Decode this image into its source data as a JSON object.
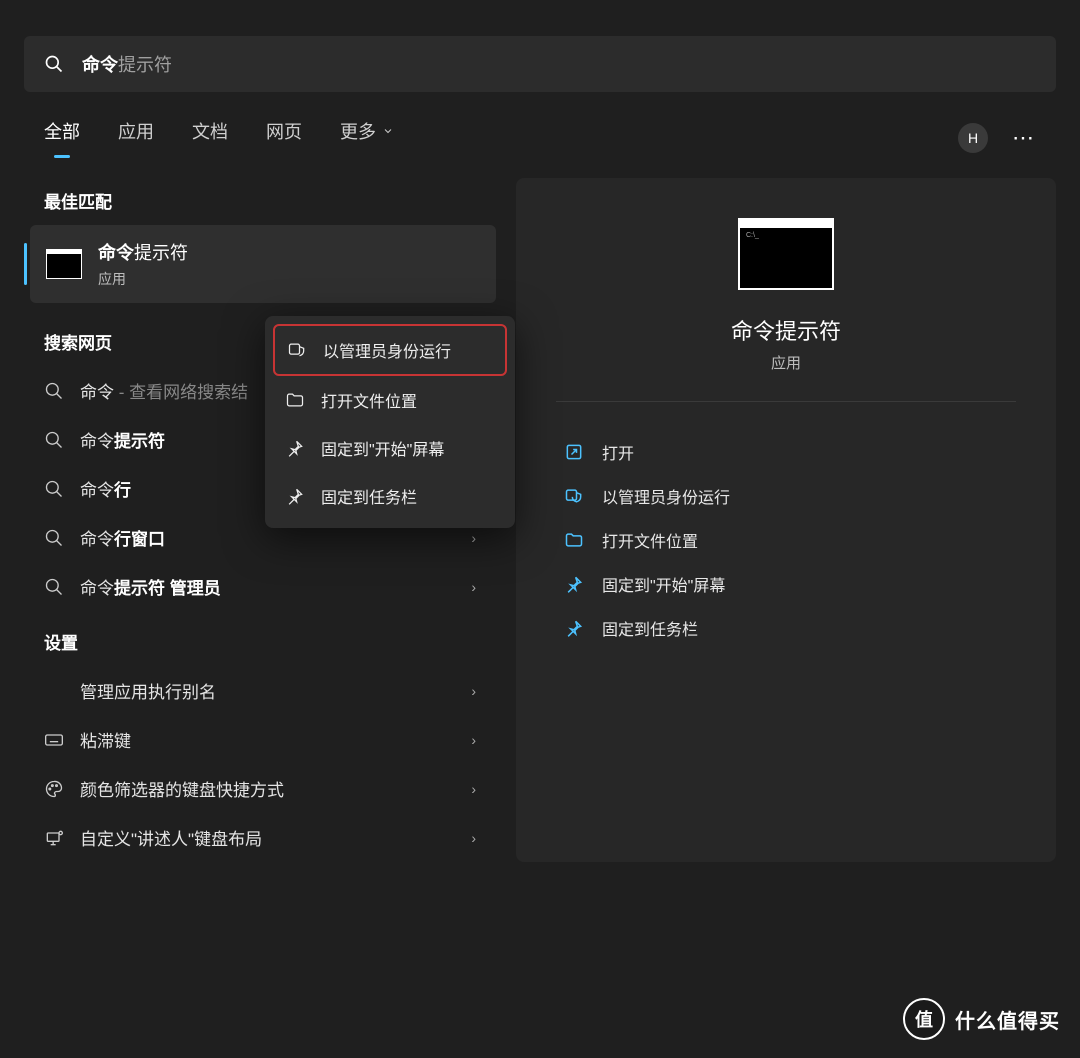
{
  "search": {
    "query_bold": "命令",
    "query_rest": "提示符"
  },
  "tabs": {
    "all": "全部",
    "apps": "应用",
    "docs": "文档",
    "web": "网页",
    "more": "更多"
  },
  "avatar_letter": "H",
  "sections": {
    "best_match": "最佳匹配",
    "search_web": "搜索网页",
    "settings": "设置"
  },
  "best_match": {
    "title_bold": "命令",
    "title_rest": "提示符",
    "subtitle": "应用"
  },
  "context_menu": {
    "run_as_admin": "以管理员身份运行",
    "open_file_location": "打开文件位置",
    "pin_to_start": "固定到\"开始\"屏幕",
    "pin_to_taskbar": "固定到任务栏"
  },
  "web_results": {
    "r1_prefix": "命令",
    "r1_suffix": " - 查看网络搜索结",
    "r2_prefix": "命令",
    "r2_bold": "提示符",
    "r3_prefix": "命令",
    "r3_bold": "行",
    "r4_prefix": "命令",
    "r4_bold": "行窗口",
    "r5_prefix": "命令",
    "r5_bold": "提示符 管理员"
  },
  "settings_results": {
    "s1": "管理应用执行别名",
    "s2": "粘滞键",
    "s3": "颜色筛选器的键盘快捷方式",
    "s4": "自定义\"讲述人\"键盘布局"
  },
  "right_panel": {
    "title": "命令提示符",
    "subtitle": "应用",
    "actions": {
      "open": "打开",
      "run_as_admin": "以管理员身份运行",
      "open_file_location": "打开文件位置",
      "pin_to_start": "固定到\"开始\"屏幕",
      "pin_to_taskbar": "固定到任务栏"
    }
  },
  "watermark": {
    "char": "值",
    "text": "什么值得买"
  }
}
